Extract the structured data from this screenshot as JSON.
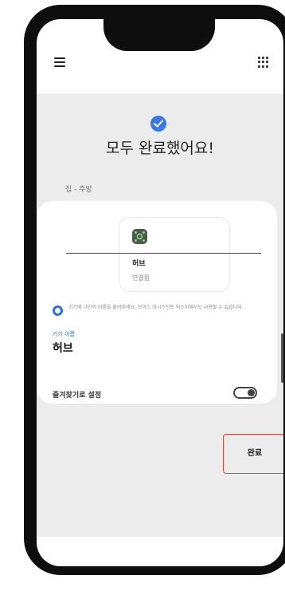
{
  "header": {
    "menu_icon": "hamburger-menu-icon",
    "apps_icon": "apps-grid-icon"
  },
  "main": {
    "title": "모두 완료했어요!",
    "location": "집 - 주방",
    "device": {
      "name": "허브",
      "status": "연결됨",
      "icon": "hub-icon"
    },
    "info_text": "기기에 나만의 이름을 붙여주세요. 보이스 어시스턴트 빅스비에서도 사용할 수 있습니다.",
    "field_label": "기기 이름",
    "field_value": "허브",
    "favorite_label": "즐겨찾기로 설정",
    "favorite_on": false
  },
  "footer": {
    "done_label": "완료"
  },
  "colors": {
    "accent": "#3b78e7",
    "highlight_border": "#e0452e",
    "background": "#ececec"
  }
}
